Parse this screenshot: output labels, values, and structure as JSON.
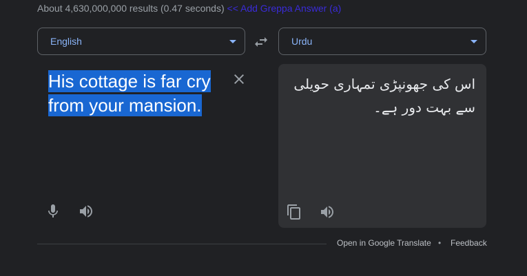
{
  "results": {
    "stats": "About 4,630,000,000 results (0.47 seconds)",
    "link": "<< Add Greppa Answer (a)"
  },
  "source": {
    "language": "English",
    "text": "His cottage is far cry from your mansion."
  },
  "target": {
    "language": "Urdu",
    "text": "اس کی جھونپڑی تمہاری حویلی سے بہت دور ہے۔"
  },
  "footer": {
    "open_link": "Open in Google Translate",
    "separator": "•",
    "feedback": "Feedback"
  },
  "icons": {
    "swap": "swap-icon",
    "clear": "close-icon",
    "mic": "microphone-icon",
    "speaker": "speaker-icon",
    "copy": "copy-icon"
  },
  "colors": {
    "background": "#202124",
    "accent": "#8ab4f8",
    "selection": "#1967d2",
    "panel": "#303134"
  }
}
